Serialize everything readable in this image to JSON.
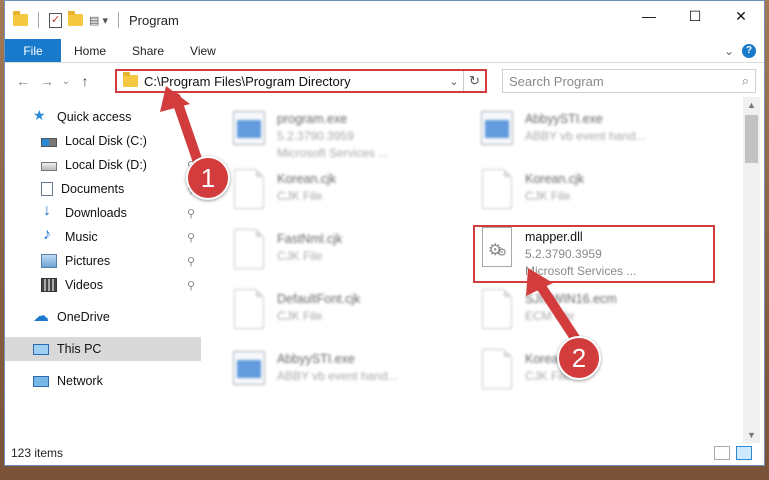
{
  "window": {
    "title": "Program",
    "controls": {
      "minimize": "—",
      "maximize": "☐",
      "close": "✕"
    }
  },
  "ribbon": {
    "tabs": [
      "File",
      "Home",
      "Share",
      "View"
    ],
    "help": "?",
    "collapse": "⌄"
  },
  "nav": {
    "back": "←",
    "forward": "→",
    "recent": "⌄",
    "up": "↑",
    "address": "C:\\Program Files\\Program Directory",
    "address_dropdown": "⌄",
    "refresh": "↻",
    "search_placeholder": "Search Program",
    "search_icon": "⌕"
  },
  "sidebar": {
    "items": [
      {
        "label": "Quick access",
        "icon": "star-icon"
      },
      {
        "label": "Local Disk (C:)",
        "icon": "disk-icon",
        "pinned": true
      },
      {
        "label": "Local Disk (D:)",
        "icon": "disk-icon",
        "pinned": true
      },
      {
        "label": "Documents",
        "icon": "documents-icon",
        "pinned": true
      },
      {
        "label": "Downloads",
        "icon": "download-icon",
        "pinned": true
      },
      {
        "label": "Music",
        "icon": "music-icon",
        "pinned": true
      },
      {
        "label": "Pictures",
        "icon": "pictures-icon",
        "pinned": true
      },
      {
        "label": "Videos",
        "icon": "videos-icon",
        "pinned": true
      },
      {
        "label": "OneDrive",
        "icon": "cloud-icon"
      },
      {
        "label": "This PC",
        "icon": "pc-icon",
        "selected": true
      },
      {
        "label": "Network",
        "icon": "network-icon"
      }
    ],
    "pin_glyph": "📌"
  },
  "files": [
    {
      "name": "program.exe",
      "line2": "5.2.3790.3959",
      "line3": "Microsoft Services ...",
      "icon": "exe-icon",
      "blurred": true
    },
    {
      "name": "AbbyySTI.exe",
      "line2": "ABBY vb event hand...",
      "line3": "",
      "icon": "exe-icon",
      "blurred": true
    },
    {
      "name": "Korean.cjk",
      "line2": "CJK File",
      "line3": "",
      "icon": "page-icon",
      "blurred": true
    },
    {
      "name": "Korean.cjk",
      "line2": "CJK File",
      "line3": "",
      "icon": "page-icon",
      "blurred": true
    },
    {
      "name": "FastNml.cjk",
      "line2": "CJK File",
      "line3": "",
      "icon": "page-icon",
      "blurred": true
    },
    {
      "name": "mapper.dll",
      "line2": "5.2.3790.3959",
      "line3": "Microsoft Services ...",
      "icon": "dll-gear-icon",
      "blurred": false
    },
    {
      "name": "DefaultFont.cjk",
      "line2": "CJK File",
      "line3": "",
      "icon": "page-icon",
      "blurred": true
    },
    {
      "name": "SJISWIN16.ecm",
      "line2": "ECM File",
      "line3": "",
      "icon": "page-icon",
      "blurred": true
    },
    {
      "name": "AbbyySTI.exe",
      "line2": "ABBY vb event hand...",
      "line3": "",
      "icon": "exe-icon",
      "blurred": true
    },
    {
      "name": "Korean.cjk",
      "line2": "CJK File",
      "line3": "",
      "icon": "page-icon",
      "blurred": true
    }
  ],
  "status": {
    "count": "123 items"
  },
  "annotations": {
    "step1": "1",
    "step2": "2",
    "color": "#d33c3c"
  }
}
